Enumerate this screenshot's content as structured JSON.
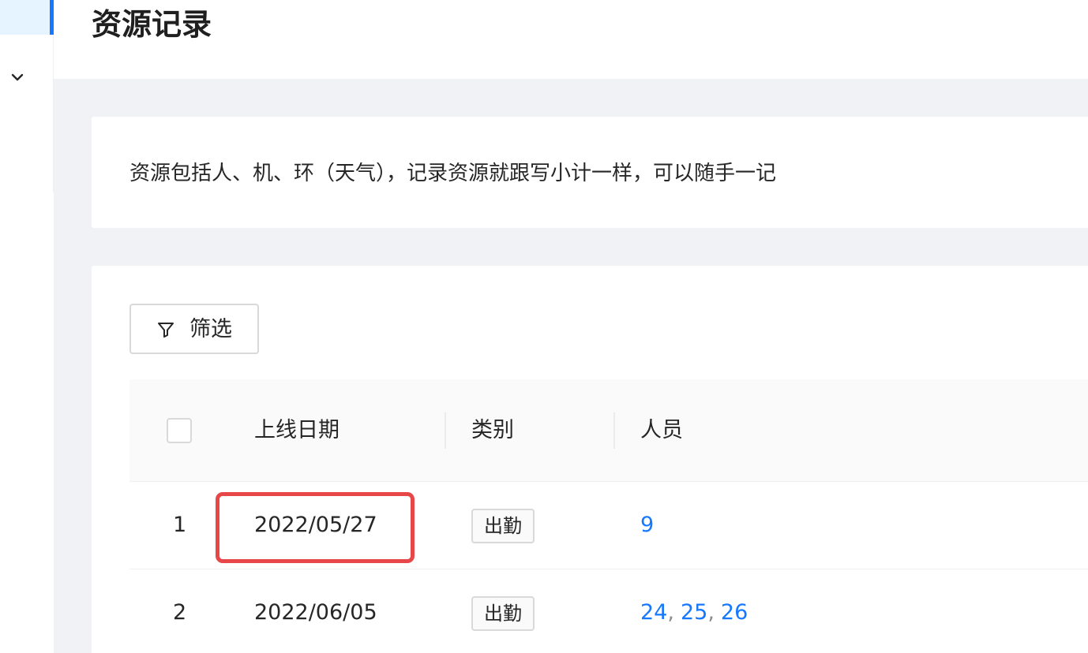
{
  "header": {
    "title": "资源记录"
  },
  "description": {
    "text": "资源包括人、机、环（天气），记录资源就跟写小计一样，可以随手一记"
  },
  "toolbar": {
    "filter_label": "筛选",
    "filter_icon": "filter-icon"
  },
  "table": {
    "columns": [
      "上线日期",
      "类别",
      "人员"
    ],
    "rows": [
      {
        "index": "1",
        "date": "2022/05/27",
        "category": "出勤",
        "persons": [
          "9"
        ]
      },
      {
        "index": "2",
        "date": "2022/06/05",
        "category": "出勤",
        "persons": [
          "24",
          "25",
          "26"
        ]
      }
    ],
    "person_separator": ","
  },
  "colors": {
    "accent": "#1677ff",
    "highlight": "#e8474a"
  }
}
